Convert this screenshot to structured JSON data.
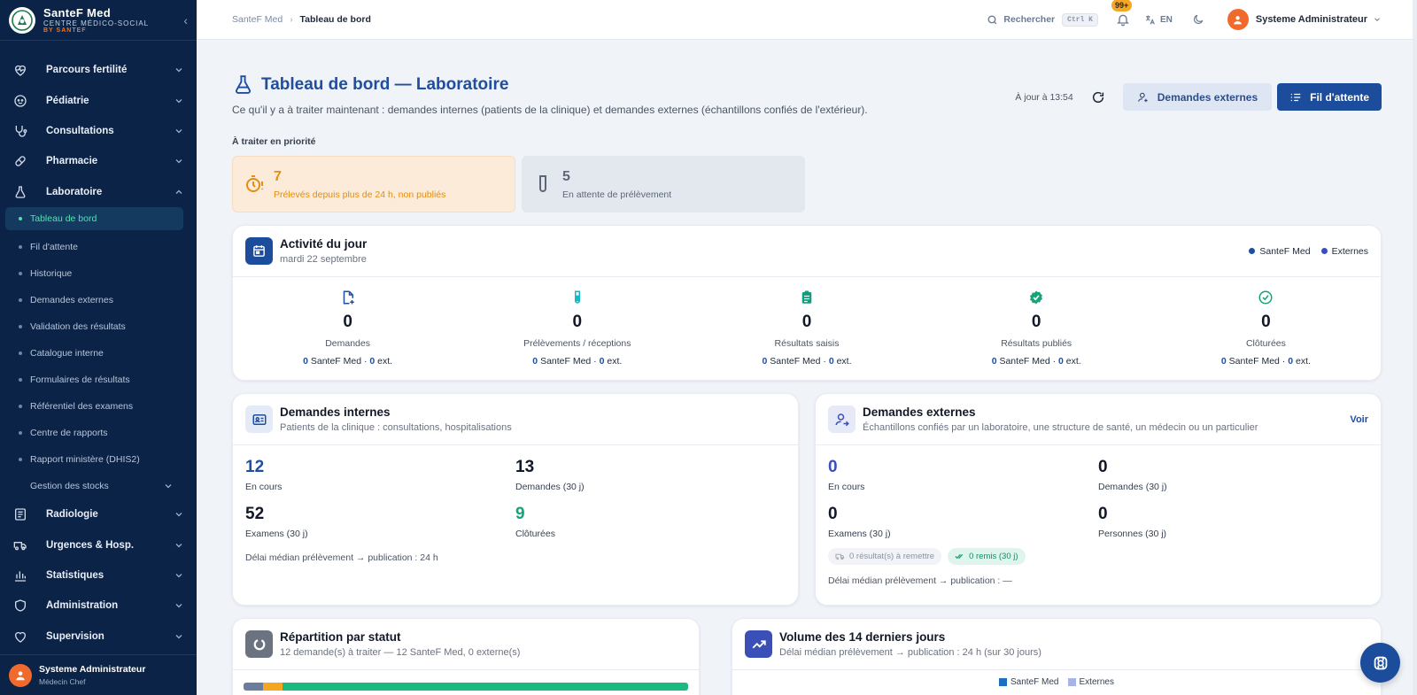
{
  "brand": {
    "name": "SanteF Med",
    "tagline": "CENTRE MÉDICO-SOCIAL",
    "by": "BY SANTEF"
  },
  "sidebar": {
    "items_top": [
      {
        "label": "Parcours fertilité",
        "icon": "heart-pulse-icon"
      },
      {
        "label": "Pédiatrie",
        "icon": "baby-icon"
      },
      {
        "label": "Consultations",
        "icon": "stethoscope-icon"
      },
      {
        "label": "Pharmacie",
        "icon": "pill-icon"
      },
      {
        "label": "Laboratoire",
        "icon": "flask-icon"
      }
    ],
    "lab_sub": [
      {
        "label": "Tableau de bord",
        "active": true
      },
      {
        "label": "Fil d'attente"
      },
      {
        "label": "Historique"
      },
      {
        "label": "Demandes externes"
      },
      {
        "label": "Validation des résultats"
      },
      {
        "label": "Catalogue interne"
      },
      {
        "label": "Formulaires de résultats"
      },
      {
        "label": "Référentiel des examens"
      },
      {
        "label": "Centre de rapports"
      },
      {
        "label": "Rapport ministère (DHIS2)"
      },
      {
        "label": "Gestion des stocks"
      }
    ],
    "items_bottom": [
      {
        "label": "Radiologie",
        "icon": "radiology-icon"
      },
      {
        "label": "Urgences & Hosp.",
        "icon": "ambulance-icon"
      },
      {
        "label": "Statistiques",
        "icon": "bar-chart-icon"
      },
      {
        "label": "Administration",
        "icon": "shield-icon"
      },
      {
        "label": "Supervision",
        "icon": "heart-monitor-icon"
      }
    ],
    "user": {
      "name": "Systeme Administrateur",
      "role": "Médecin Chef"
    }
  },
  "topbar": {
    "breadcrumb": [
      "SanteF Med",
      "Tableau de bord"
    ],
    "search_label": "Rechercher",
    "search_shortcut": "Ctrl K",
    "notif_badge": "99+",
    "lang": "EN",
    "user_name": "Systeme Administrateur"
  },
  "page": {
    "title": "Tableau de bord — Laboratoire",
    "subtitle": "Ce qu'il y a à traiter maintenant : demandes internes (patients de la clinique) et demandes externes (échantillons confiés de l'extérieur).",
    "updated": "À jour à 13:54",
    "btn_external": "Demandes externes",
    "btn_queue": "Fil d'attente",
    "priority_label": "À traiter en priorité",
    "priorities": [
      {
        "value": "7",
        "label": "Prélevés depuis plus de 24 h, non publiés"
      },
      {
        "value": "5",
        "label": "En attente de prélèvement"
      }
    ]
  },
  "activity": {
    "title": "Activité du jour",
    "date": "mardi 22 septembre",
    "legend": [
      "SanteF Med",
      "Externes"
    ],
    "colors": {
      "santef": "#1f4e9e",
      "externes": "#3b4fb8"
    },
    "items": [
      {
        "value": "0",
        "label": "Demandes",
        "int": "0",
        "ext": "0"
      },
      {
        "value": "0",
        "label": "Prélèvements / réceptions",
        "int": "0",
        "ext": "0"
      },
      {
        "value": "0",
        "label": "Résultats saisis",
        "int": "0",
        "ext": "0"
      },
      {
        "value": "0",
        "label": "Résultats publiés",
        "int": "0",
        "ext": "0"
      },
      {
        "value": "0",
        "label": "Clôturées",
        "int": "0",
        "ext": "0"
      }
    ],
    "int_suffix": "SanteF Med ·",
    "ext_suffix": "ext."
  },
  "internal": {
    "title": "Demandes internes",
    "subtitle": "Patients de la clinique : consultations, hospitalisations",
    "stats": [
      {
        "value": "12",
        "label": "En cours"
      },
      {
        "value": "13",
        "label": "Demandes (30 j)"
      },
      {
        "value": "52",
        "label": "Examens (30 j)"
      },
      {
        "value": "9",
        "label": "Clôturées"
      }
    ],
    "delay": "Délai médian prélèvement → publication : 24 h"
  },
  "external": {
    "title": "Demandes externes",
    "subtitle": "Échantillons confiés par un laboratoire, une structure de santé, un médecin ou un particulier",
    "link": "Voir",
    "stats": [
      {
        "value": "0",
        "label": "En cours"
      },
      {
        "value": "0",
        "label": "Demandes (30 j)"
      },
      {
        "value": "0",
        "label": "Examens (30 j)"
      },
      {
        "value": "0",
        "label": "Personnes (30 j)"
      }
    ],
    "chip_pending": "0 résultat(s) à remettre",
    "chip_done": "0 remis (30 j)",
    "delay": "Délai médian prélèvement → publication : —"
  },
  "status": {
    "title": "Répartition par statut",
    "subtitle": "12 demande(s) à traiter — 12 SanteF Med, 0 externe(s)"
  },
  "volume": {
    "title": "Volume des 14 derniers jours",
    "subtitle": "Délai médian prélèvement → publication : 24 h (sur 30 jours)",
    "legend": [
      "SanteF Med",
      "Externes"
    ]
  }
}
